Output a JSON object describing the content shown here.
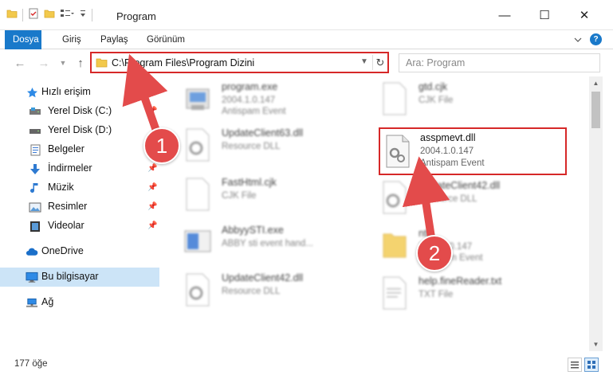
{
  "window": {
    "title": "Program",
    "min_glyph": "—",
    "max_glyph": "☐",
    "close_glyph": "✕"
  },
  "ribbon": {
    "tabs": [
      "Dosya",
      "Giriş",
      "Paylaş",
      "Görünüm"
    ],
    "help": "?"
  },
  "address": {
    "path": "C:\\Program Files\\Program Dizini",
    "search_placeholder": "Ara: Program"
  },
  "sidebar": {
    "items": [
      {
        "label": "Hızlı erişim",
        "icon": "star-icon",
        "pinned": false
      },
      {
        "label": "Yerel Disk (C:)",
        "icon": "drive-icon",
        "pinned": true
      },
      {
        "label": "Yerel Disk (D:)",
        "icon": "drive-icon",
        "pinned": true
      },
      {
        "label": "Belgeler",
        "icon": "documents-icon",
        "pinned": true
      },
      {
        "label": "İndirmeler",
        "icon": "download-icon",
        "pinned": true
      },
      {
        "label": "Müzik",
        "icon": "music-icon",
        "pinned": true
      },
      {
        "label": "Resimler",
        "icon": "pictures-icon",
        "pinned": true
      },
      {
        "label": "Videolar",
        "icon": "video-icon",
        "pinned": true
      },
      {
        "label": "OneDrive",
        "icon": "cloud-icon",
        "pinned": false
      },
      {
        "label": "Bu bilgisayar",
        "icon": "computer-icon",
        "pinned": false
      },
      {
        "label": "Ağ",
        "icon": "network-icon",
        "pinned": false
      }
    ]
  },
  "files": {
    "left": [
      {
        "name": "program.exe",
        "line2": "2004.1.0.147",
        "line3": "Antispam Event"
      },
      {
        "name": "UpdateClient63.dll",
        "line2": "Resource DLL",
        "line3": ""
      },
      {
        "name": "FastHtml.cjk",
        "line2": "CJK File",
        "line3": ""
      },
      {
        "name": "AbbyySTI.exe",
        "line2": "ABBY sti event hand...",
        "line3": ""
      },
      {
        "name": "UpdateClient42.dll",
        "line2": "Resource DLL",
        "line3": ""
      }
    ],
    "right": [
      {
        "name": "gtd.cjk",
        "line2": "CJK File",
        "line3": ""
      },
      {
        "name": "asspmevt.dll",
        "line2": "2004.1.0.147",
        "line3": "Antispam Event"
      },
      {
        "name": "UpdateClient42.dll",
        "line2": "Resource DLL",
        "line3": ""
      },
      {
        "name": "ntd",
        "line2": "2004.1.0.147",
        "line3": "Antispam Event"
      },
      {
        "name": "help.fineReader.txt",
        "line2": "TXT File",
        "line3": ""
      }
    ]
  },
  "status": {
    "count": "177 öğe"
  },
  "annotations": {
    "step1": "1",
    "step2": "2",
    "color": "#e34b4b"
  }
}
